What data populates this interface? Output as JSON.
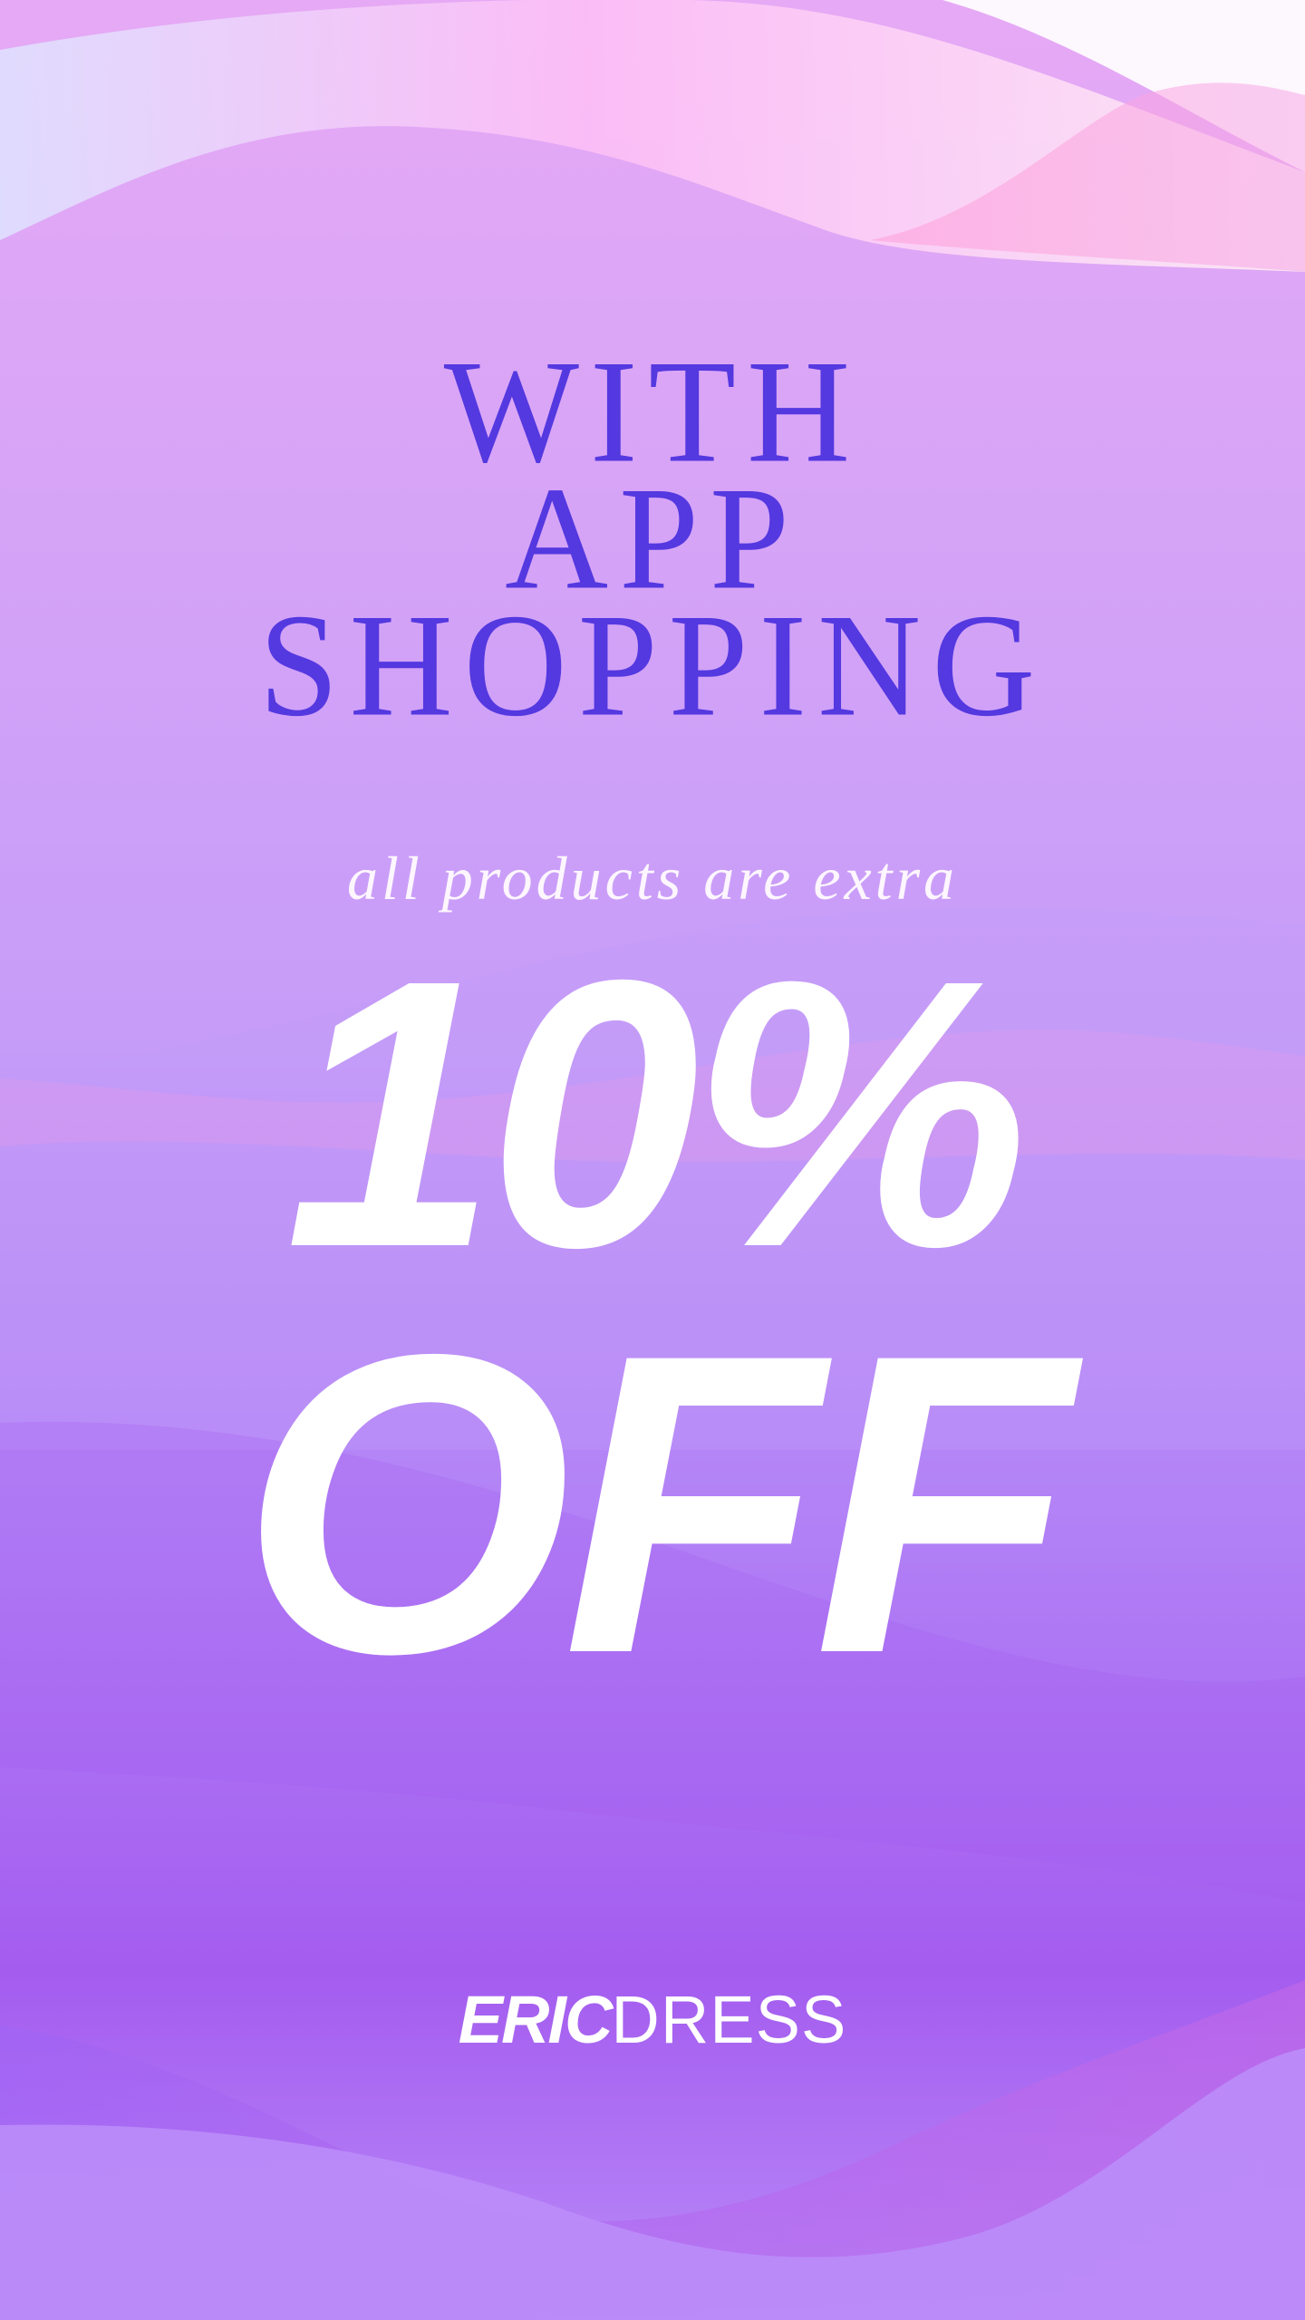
{
  "headline": {
    "line1": "WITH",
    "line2": "APP",
    "line3": "SHOPPING"
  },
  "subline": "all products are extra",
  "discount": {
    "amount": "10%",
    "label": "OFF"
  },
  "brand": {
    "part1": "ERIC",
    "part2": "DRESS"
  },
  "colors": {
    "headline": "#5438e0",
    "offer_text": "#ffffff",
    "background_top": "#e6a9f5",
    "background_bottom": "#a45cef"
  }
}
